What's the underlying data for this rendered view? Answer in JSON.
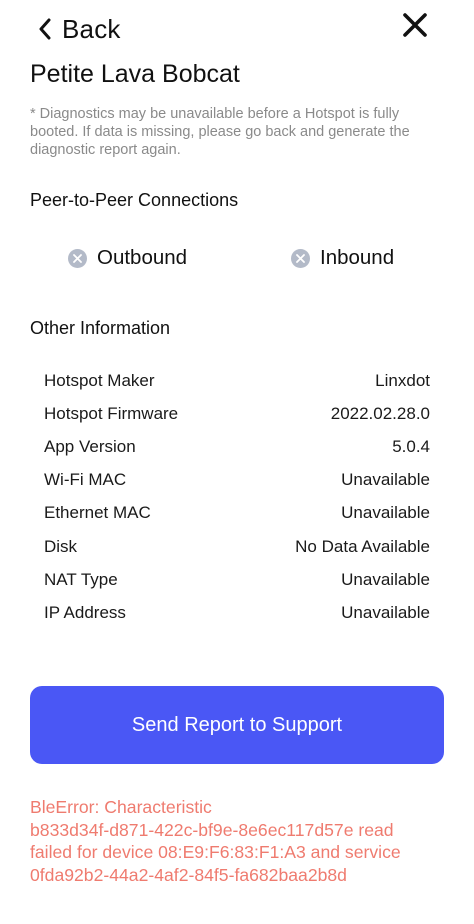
{
  "header": {
    "back_label": "Back",
    "back_icon": "chevron-left-icon",
    "close_icon": "close-icon"
  },
  "title": "Petite Lava Bobcat",
  "disclaimer": "* Diagnostics may be unavailable before a Hotspot is fully booted. If data is missing, please go back and generate the diagnostic report again.",
  "p2p": {
    "section_title": "Peer-to-Peer Connections",
    "outbound": {
      "label": "Outbound",
      "icon": "x-circle-icon",
      "status": "disconnected"
    },
    "inbound": {
      "label": "Inbound",
      "icon": "x-circle-icon",
      "status": "disconnected"
    }
  },
  "other": {
    "section_title": "Other Information",
    "rows": [
      {
        "label": "Hotspot Maker",
        "value": "Linxdot"
      },
      {
        "label": "Hotspot Firmware",
        "value": "2022.02.28.0"
      },
      {
        "label": "App Version",
        "value": "5.0.4"
      },
      {
        "label": "Wi-Fi MAC",
        "value": "Unavailable"
      },
      {
        "label": "Ethernet MAC",
        "value": "Unavailable"
      },
      {
        "label": "Disk",
        "value": "No Data Available"
      },
      {
        "label": "NAT Type",
        "value": "Unavailable"
      },
      {
        "label": "IP Address",
        "value": "Unavailable"
      }
    ]
  },
  "send_button_label": "Send Report to Support",
  "error": {
    "lines": [
      "BleError: Characteristic",
      "b833d34f-d871-422c-bf9e-8e6ec117d57e read",
      "failed for device 08:E9:F6:83:F1:A3 and service",
      "0fda92b2-44a2-4af2-84f5-fa682baa2b8d"
    ]
  },
  "colors": {
    "accent": "#4a57f5",
    "error": "#ef7b6f",
    "muted_text": "#8a8a8a",
    "icon_gray": "#b3bac8"
  }
}
